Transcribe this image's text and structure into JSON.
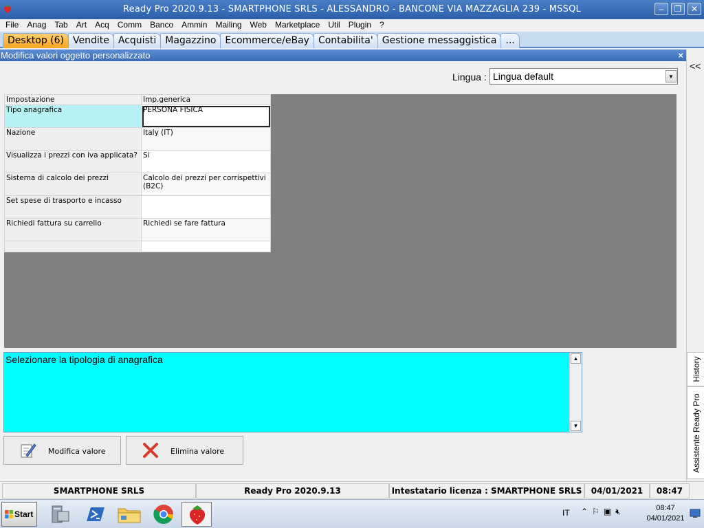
{
  "window": {
    "title": "Ready Pro 2020.9.13 - SMARTPHONE SRLS - ALESSANDRO - BANCONE VIA MAZZAGLIA 239 - MSSQL",
    "controls": {
      "minimize": "–",
      "restore": "❐",
      "close": "✕"
    }
  },
  "menu": [
    "File",
    "Anag",
    "Tab",
    "Art",
    "Acq",
    "Comm",
    "Banco",
    "Ammin",
    "Mailing",
    "Web",
    "Marketplace",
    "Util",
    "Plugin",
    "?"
  ],
  "tabs": [
    "Desktop (6)",
    "Vendite",
    "Acquisti",
    "Magazzino",
    "Ecommerce/eBay",
    "Contabilita'",
    "Gestione messaggistica",
    "..."
  ],
  "active_tab_index": 0,
  "panel": {
    "title": "Modifica valori oggetto personalizzato",
    "close_glyph": "×"
  },
  "lingua": {
    "label": "Lingua :",
    "value": "Lingua default"
  },
  "grid": {
    "headers": [
      "Impostazione",
      "Imp.generica"
    ],
    "rows": [
      {
        "key": "Tipo anagrafica",
        "value": "PERSONA FISICA"
      },
      {
        "key": "Nazione",
        "value": "Italy (IT)"
      },
      {
        "key": "Visualizza i prezzi con iva applicata?",
        "value": "Si"
      },
      {
        "key": "Sistema di calcolo dei prezzi",
        "value": "Calcolo dei prezzi per corrispettivi (B2C)"
      },
      {
        "key": "Set spese di trasporto e incasso",
        "value": ""
      },
      {
        "key": "Richiedi fattura su carrello",
        "value": "Richiedi se fare fattura"
      },
      {
        "key": "",
        "value": ""
      }
    ]
  },
  "description": "Selezionare la tipologia di anagrafica",
  "buttons": {
    "modify": "Modifica valore",
    "delete": "Elimina valore"
  },
  "dock": {
    "collapse": "<<",
    "history": "History",
    "assistant": "Assistente Ready Pro"
  },
  "status": {
    "company": "SMARTPHONE SRLS",
    "version": "Ready Pro 2020.9.13",
    "license": "Intestatario licenza : SMARTPHONE SRLS",
    "date": "04/01/2021",
    "time": "08:47"
  },
  "taskbar": {
    "start": "Start",
    "lang": "IT",
    "clock_time": "08:47",
    "clock_date": "04/01/2021"
  },
  "colors": {
    "selected_row": "#b6f2f4",
    "description_bg": "#00ffff",
    "active_tab": "#f7a520",
    "grid_background": "#808080"
  }
}
